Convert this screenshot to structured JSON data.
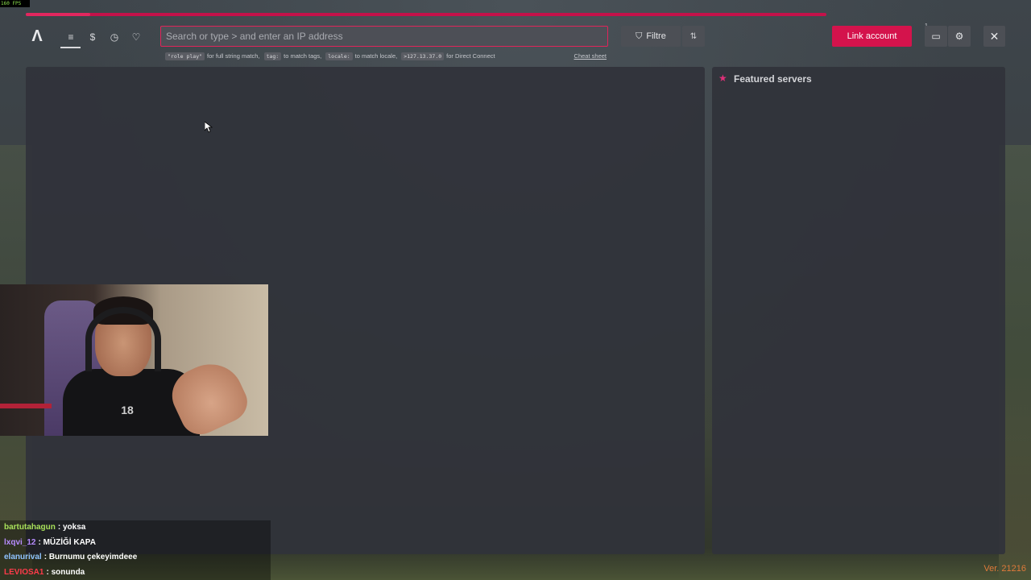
{
  "overlay": {
    "fps_label": "160 FPS"
  },
  "progress": {
    "value": 0.08,
    "color": "#e2275f"
  },
  "nav": {
    "logo_glyph": "Λ",
    "items": [
      {
        "name": "list",
        "icon": "list-icon",
        "glyph": "≡",
        "active": true
      },
      {
        "name": "supporters",
        "icon": "dollar-icon",
        "glyph": "$"
      },
      {
        "name": "history",
        "icon": "clock-icon",
        "glyph": "◷"
      },
      {
        "name": "favorites",
        "icon": "heart-icon",
        "glyph": "♡"
      }
    ]
  },
  "search": {
    "placeholder": "Search or type > and enter an IP address",
    "value": ""
  },
  "hints": [
    {
      "code": "\"role play\"",
      "text": "for full string match,"
    },
    {
      "code": "tag:",
      "text": "to match tags,"
    },
    {
      "code": "locale:",
      "text": "to match locale,"
    },
    {
      "code": ">127.13.37.0",
      "text": "for Direct Connect"
    }
  ],
  "cheat_sheet_label": "Cheat sheet",
  "toolbar": {
    "filter_label": "Filtre",
    "filter_icon_glyph": "⛉",
    "sort_icon_glyph": "⇅",
    "link_account_label": "Link account",
    "notifications_badge": "1",
    "notifications_icon_glyph": "▭",
    "settings_icon_glyph": "⚙",
    "close_icon_glyph": "✕"
  },
  "featured": {
    "title": "Featured servers",
    "star_glyph": "★"
  },
  "webcam": {
    "shirt_print": "18"
  },
  "chat": [
    {
      "user": "bartutahagun",
      "message": "yoksa",
      "color": "#a8e05a"
    },
    {
      "user": "lxqvi_12",
      "message": "MÜZİĞİ KAPA",
      "color": "#b78cff"
    },
    {
      "user": "elanurival",
      "message": "Burnumu çekeyimdeee",
      "color": "#8fc3ff"
    },
    {
      "user": "LEVIOSA1",
      "message": "sonunda",
      "color": "#ff3b4a"
    }
  ],
  "version": "Ver. 21216",
  "colors": {
    "accent": "#d4134c",
    "panel": "#30333a"
  }
}
